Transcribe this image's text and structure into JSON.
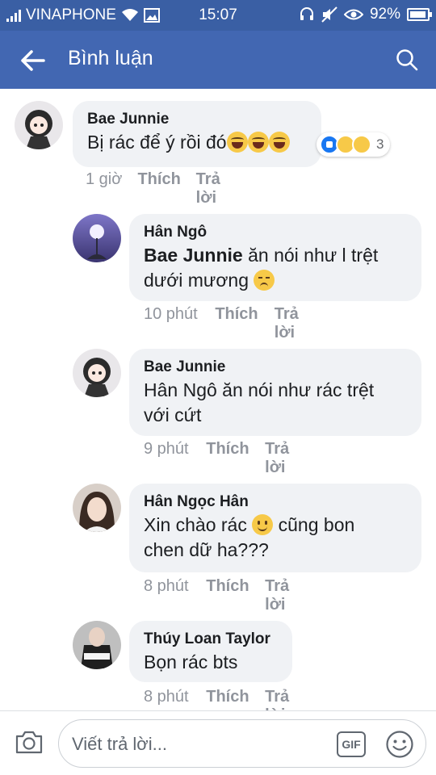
{
  "status_bar": {
    "carrier": "VINAPHONE",
    "time": "15:07",
    "battery": "92%"
  },
  "header": {
    "title": "Bình luận"
  },
  "comments": [
    {
      "author": "Bae Junnie",
      "text": "Bị rác để ý rồi đó",
      "time": "1 giờ",
      "like_label": "Thích",
      "reply_label": "Trả lời",
      "reaction_count": "3"
    },
    {
      "author": "Hân Ngô",
      "mention": "Bae Junnie",
      "text": " ăn nói như l trệt dưới mương",
      "time": "10 phút",
      "like_label": "Thích",
      "reply_label": "Trả lời"
    },
    {
      "author": "Bae Junnie",
      "text": "Hân Ngô ăn nói như rác trệt với cứt",
      "time": "9 phút",
      "like_label": "Thích",
      "reply_label": "Trả lời"
    },
    {
      "author": "Hân Ngọc Hân",
      "text_before": "Xin chào rác",
      "text_after": " cũng bon chen dữ ha???",
      "time": "8 phút",
      "like_label": "Thích",
      "reply_label": "Trả lời"
    },
    {
      "author": "Thúy Loan Taylor",
      "text": "Bọn rác bts",
      "time": "8 phút",
      "like_label": "Thích",
      "reply_label": "Trả lời"
    }
  ],
  "reply_bar": {
    "placeholder": "Viết trả lời...",
    "gif_label": "GIF"
  },
  "colors": {
    "status_bar": "#3a5fa4",
    "header": "#4267b2",
    "bubble": "#f0f2f5",
    "meta_text": "#90949c"
  }
}
